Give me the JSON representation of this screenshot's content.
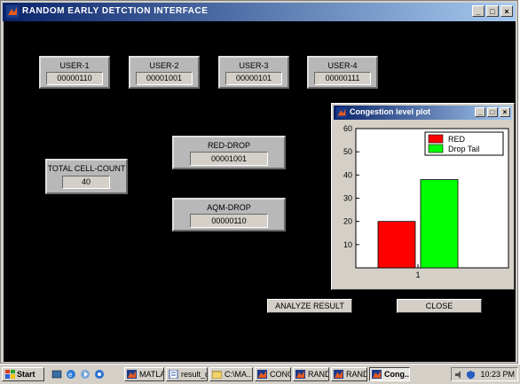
{
  "window": {
    "title": "RANDOM EARLY DETCTION INTERFACE",
    "controls": [
      "_",
      "□",
      "×"
    ]
  },
  "users": [
    {
      "label": "USER-1",
      "value": "00000110"
    },
    {
      "label": "USER-2",
      "value": "00001001"
    },
    {
      "label": "USER-3",
      "value": "00000101"
    },
    {
      "label": "USER-4",
      "value": "00000111"
    }
  ],
  "total_cell_count": {
    "label": "TOTAL CELL-COUNT",
    "value": "40"
  },
  "red_drop": {
    "label": "RED-DROP",
    "value": "00001001"
  },
  "aqm_drop": {
    "label": "AQM-DROP",
    "value": "00000110"
  },
  "buttons": {
    "analyze": "ANALYZE RESULT",
    "close": "CLOSE"
  },
  "plot_window": {
    "title": "Congestion level plot",
    "controls": [
      "_",
      "□",
      "×"
    ]
  },
  "chart_data": {
    "type": "bar",
    "categories": [
      "1"
    ],
    "series": [
      {
        "name": "RED",
        "values": [
          20
        ],
        "color": "#ff0000"
      },
      {
        "name": "Drop Tail",
        "values": [
          38
        ],
        "color": "#00ff00"
      }
    ],
    "ylim": [
      0,
      60
    ],
    "yticks": [
      10,
      20,
      30,
      40,
      50,
      60
    ],
    "legend": "top-right",
    "grid": false
  },
  "taskbar": {
    "start": "Start",
    "items": [
      {
        "label": "MATLAB",
        "icon": "matlab-icon",
        "active": false
      },
      {
        "label": "result_c...",
        "icon": "document-icon",
        "active": false
      },
      {
        "label": "C:\\MA...",
        "icon": "folder-icon",
        "active": false
      },
      {
        "label": "CONG...",
        "icon": "matlab-icon",
        "active": false
      },
      {
        "label": "RAND...",
        "icon": "matlab-icon",
        "active": false
      },
      {
        "label": "RAND...",
        "icon": "matlab-icon",
        "active": false
      },
      {
        "label": "Cong...",
        "icon": "matlab-icon",
        "active": true
      }
    ],
    "clock": "10:23 PM"
  }
}
